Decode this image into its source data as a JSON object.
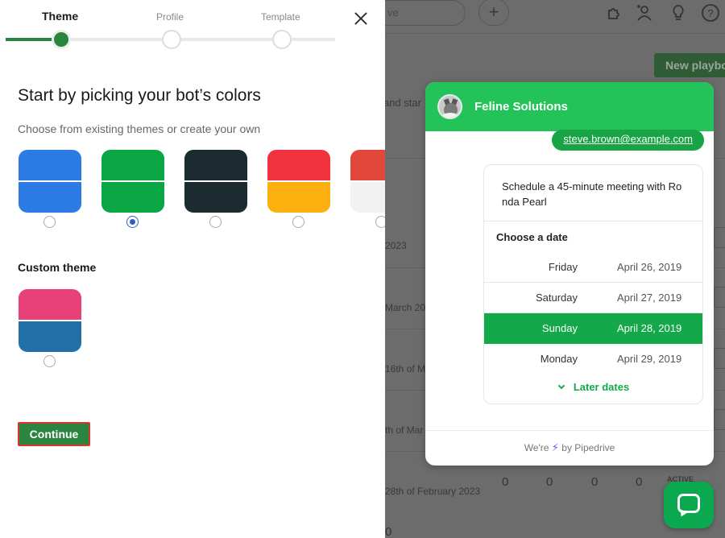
{
  "stepper": {
    "steps": [
      {
        "label": "Theme",
        "state": "active"
      },
      {
        "label": "Profile",
        "state": "pending"
      },
      {
        "label": "Template",
        "state": "pending"
      }
    ]
  },
  "panel": {
    "heading": "Start by picking your bot’s colors",
    "subheading": "Choose from existing themes or create your own",
    "themes": [
      {
        "top": "#2c7be5",
        "bottom": "#2c7be5",
        "selected": false
      },
      {
        "top": "#0aa644",
        "bottom": "#0aa644",
        "selected": true
      },
      {
        "top": "#1c2b30",
        "bottom": "#1c2b30",
        "selected": false
      },
      {
        "top": "#f0323d",
        "bottom": "#fbb010",
        "selected": false
      },
      {
        "top": "#e2473b",
        "bottom": "#f2f2f2",
        "selected": false
      }
    ],
    "custom_label": "Custom theme",
    "custom_theme": {
      "top": "#e8417a",
      "bottom": "#2171a8",
      "selected": false
    },
    "continue_label": "Continue"
  },
  "widget": {
    "title": "Feline Solutions",
    "email": "steve.brown@example.com",
    "message": "Schedule a 45-minute meeting with Ronda Pearl",
    "choose_label": "Choose a date",
    "dates": [
      {
        "day": "Friday",
        "date": "April 26, 2019",
        "selected": false
      },
      {
        "day": "Saturday",
        "date": "April 27, 2019",
        "selected": false
      },
      {
        "day": "Sunday",
        "date": "April 28, 2019",
        "selected": true
      },
      {
        "day": "Monday",
        "date": "April 29, 2019",
        "selected": false
      }
    ],
    "later_label": "Later dates",
    "footer_prefix": "We're",
    "footer_suffix": "by Pipedrive"
  },
  "background": {
    "search_fragment": "ve",
    "new_button_fragment": "New playbo",
    "text_fragment_1": "and star",
    "row_dates": [
      "2023",
      "March 202",
      "16th of M",
      "th of Mar",
      "28th of February 2023"
    ],
    "counts": [
      "0",
      "0",
      "0",
      "0"
    ],
    "status_fragment": "ACTIVE",
    "bottom_fragment": "0"
  },
  "colors": {
    "brand_green": "#2b8540",
    "widget_green": "#24c35a",
    "selected_radio": "#2d5ec8",
    "continue_border": "#d7382e"
  }
}
